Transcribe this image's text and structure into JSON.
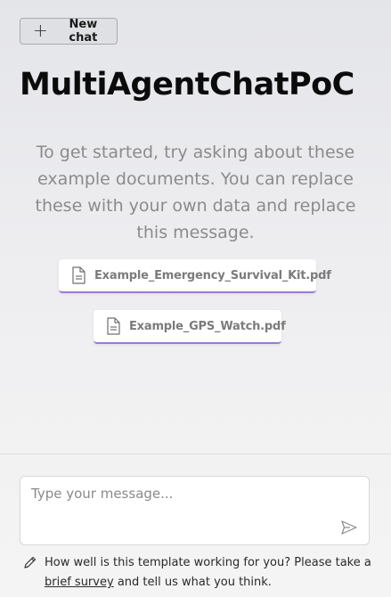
{
  "header": {
    "new_chat_label": "New chat",
    "app_title": "MultiAgentChatPoC"
  },
  "intro": {
    "message": "To get started, try asking about these example documents. You can replace these with your own data and replace this message."
  },
  "documents": [
    {
      "name": "Example_Emergency_Survival_Kit.pdf",
      "icon": "file-icon"
    },
    {
      "name": "Example_GPS_Watch.pdf",
      "icon": "file-icon"
    }
  ],
  "composer": {
    "placeholder": "Type your message...",
    "send_icon": "send-icon"
  },
  "survey": {
    "icon": "pencil-icon",
    "text_before": "How well is this template working for you? Please take a",
    "link_text": "brief survey",
    "text_after": "and tell us what you think."
  },
  "colors": {
    "accent": "#9b79db",
    "muted_text": "#8b8b8b"
  }
}
